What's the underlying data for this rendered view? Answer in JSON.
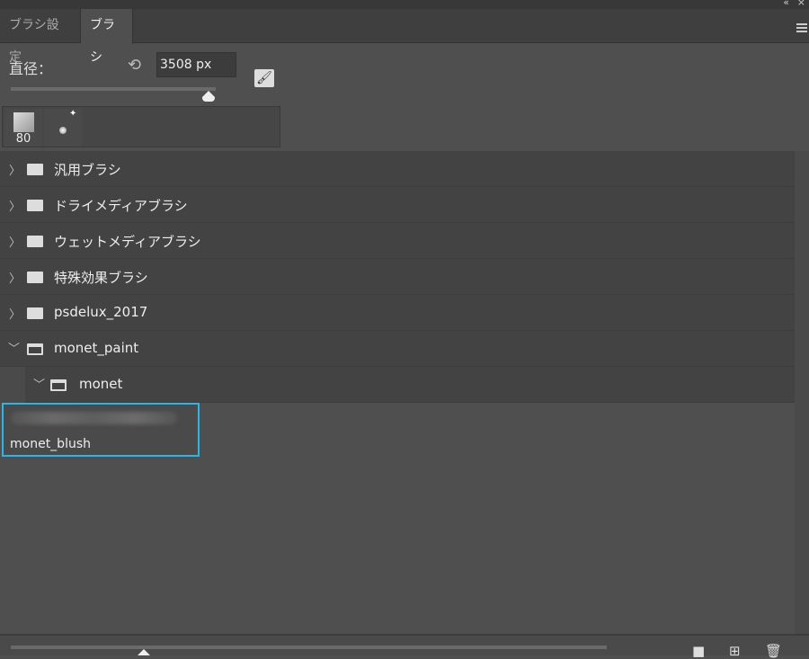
{
  "window": {
    "collapse_icon": "«",
    "close_icon": "×"
  },
  "tabs": [
    {
      "label": "ブラシ設定"
    },
    {
      "label": "ブラシ"
    }
  ],
  "diameter": {
    "label": "直径：",
    "value": "3508 px",
    "slider_fraction": 0.97
  },
  "recent_brushes": [
    {
      "size": "80"
    },
    {
      "size": ""
    }
  ],
  "folders": [
    {
      "name": "汎用ブラシ",
      "expanded": false
    },
    {
      "name": "ドライメディアブラシ",
      "expanded": false
    },
    {
      "name": "ウェットメディアブラシ",
      "expanded": false
    },
    {
      "name": "特殊効果ブラシ",
      "expanded": false
    },
    {
      "name": "psdelux_2017",
      "expanded": false
    },
    {
      "name": "monet_paint",
      "expanded": true
    },
    {
      "name": "monet",
      "expanded": true
    }
  ],
  "selected_brush": {
    "name": "monet_blush"
  },
  "bottom": {
    "preview_size_fraction": 0.23
  },
  "colors": {
    "accent": "#29b6e8",
    "panel": "#4f4f4f"
  }
}
